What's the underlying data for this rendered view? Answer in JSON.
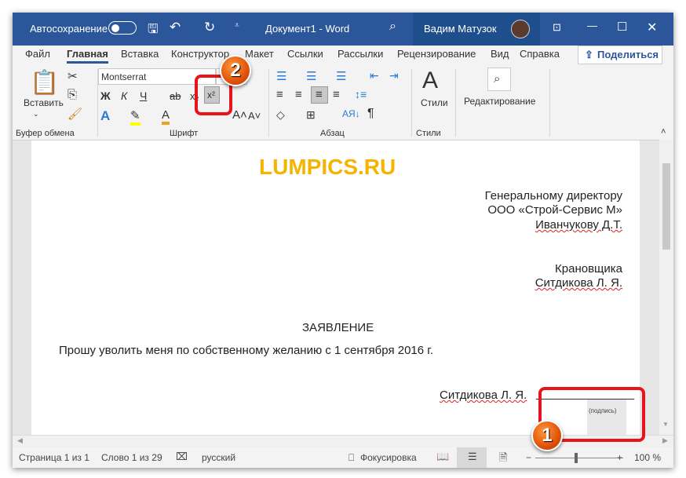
{
  "titlebar": {
    "autosave": "Автосохранение",
    "doc_title": "Документ1  -  Word",
    "user": "Вадим Матузок",
    "accent": "#2b579a"
  },
  "tabs": [
    "Файл",
    "Главная",
    "Вставка",
    "Конструктор",
    "Макет",
    "Ссылки",
    "Рассылки",
    "Рецензирование",
    "Вид",
    "Справка"
  ],
  "share": "Поделиться",
  "ribbon": {
    "paste": "Вставить",
    "font_name": "Montserrat",
    "groups": {
      "clipboard": "Буфер обмена",
      "font": "Шрифт",
      "paragraph": "Абзац",
      "styles": "Стили"
    },
    "styles": "Стили",
    "editing": "Редактирование",
    "bold": "Ж",
    "italic": "К",
    "underline": "Ч",
    "strike": "ab",
    "sub": "x₂",
    "sup": "x²",
    "pilcrow": "¶"
  },
  "document": {
    "watermark": "LUMPICS.RU",
    "addressee": [
      "Генеральному директору",
      "ООО «Строй-Сервис М»",
      "Иванчукову Д.Т."
    ],
    "from": [
      "Крановщика",
      "Ситдикова Л. Я."
    ],
    "heading": "ЗАЯВЛЕНИЕ",
    "body": "Прошу уволить меня по собственному желанию с 1 сентября 2016 г.",
    "signature_name": "Ситдикова Л. Я.",
    "signature_line": "_______________",
    "signature_caption": "(подпись)"
  },
  "annotations": {
    "step1": "1",
    "step2": "2"
  },
  "status": {
    "page": "Страница 1 из 1",
    "words": "Слово 1 из 29",
    "language": "русский",
    "focus": "Фокусировка",
    "zoom": "100 %",
    "zoom_minus": "−",
    "zoom_plus": "+"
  }
}
